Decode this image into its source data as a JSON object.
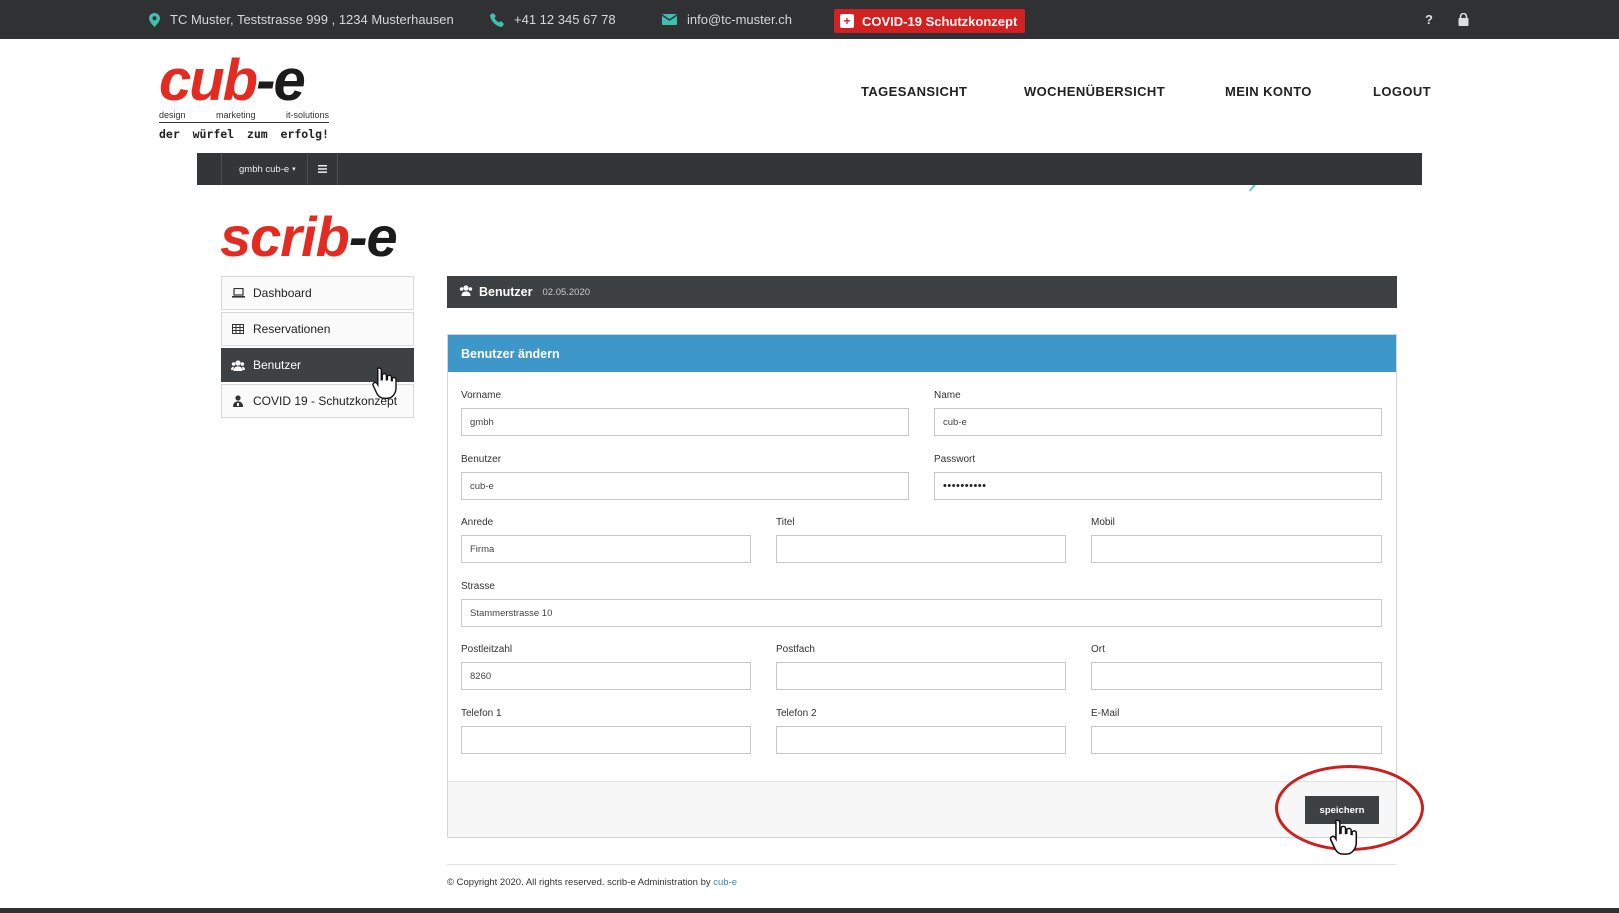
{
  "topbar": {
    "address": "TC Muster, Teststrasse 999 , 1234 Musterhausen",
    "phone": "+41 12 345 67 78",
    "email": "info@tc-muster.ch",
    "covid_button": "COVID-19 Schutzkonzept",
    "help_symbol": "?",
    "icons": [
      "location-icon",
      "phone-icon",
      "mail-icon",
      "help-icon",
      "lock-icon"
    ]
  },
  "logo": {
    "part_red": "cub",
    "part_dark": "-e",
    "tagline": [
      "design",
      "marketing",
      "it-solutions"
    ],
    "slogan": [
      "der",
      "würfel",
      "zum",
      "erfolg!"
    ]
  },
  "nav": {
    "items": [
      "TAGESANSICHT",
      "WOCHENÜBERSICHT",
      "MEIN KONTO",
      "LOGOUT"
    ]
  },
  "adminbar": {
    "user_label": "gmbh cub-e",
    "caret": "▾",
    "menu_icon": "menu-icon"
  },
  "app_logo": {
    "part_red": "scrib",
    "part_dark": "-e"
  },
  "sidebar": {
    "items": [
      {
        "label": "Dashboard",
        "icon": "laptop-icon",
        "active": false
      },
      {
        "label": "Reservationen",
        "icon": "table-icon",
        "active": false
      },
      {
        "label": "Benutzer",
        "icon": "users-icon",
        "active": true
      },
      {
        "label": "COVID 19 - Schutzkonzept",
        "icon": "person-badge-icon",
        "active": false
      }
    ]
  },
  "page_header": {
    "title": "Benutzer",
    "date": "02.05.2020",
    "icon": "users-icon"
  },
  "form": {
    "heading": "Benutzer ändern",
    "fields": {
      "vorname": {
        "label": "Vorname",
        "value": "gmbh"
      },
      "name": {
        "label": "Name",
        "value": "cub-e"
      },
      "benutzer": {
        "label": "Benutzer",
        "value": "cub-e"
      },
      "passwort": {
        "label": "Passwort",
        "value": "••••••••••"
      },
      "anrede": {
        "label": "Anrede",
        "value": "Firma"
      },
      "titel": {
        "label": "Titel",
        "value": ""
      },
      "mobil": {
        "label": "Mobil",
        "value": ""
      },
      "strasse": {
        "label": "Strasse",
        "value": "Stammerstrasse 10"
      },
      "postleitzahl": {
        "label": "Postleitzahl",
        "value": "8260"
      },
      "postfach": {
        "label": "Postfach",
        "value": ""
      },
      "ort": {
        "label": "Ort",
        "value": ""
      },
      "telefon1": {
        "label": "Telefon 1",
        "value": ""
      },
      "telefon2": {
        "label": "Telefon 2",
        "value": ""
      },
      "email": {
        "label": "E-Mail",
        "value": ""
      }
    },
    "save_label": "speichern"
  },
  "footer": {
    "text": "© Copyright 2020. All rights reserved. scrib-e Administration by",
    "link": "cub-e"
  },
  "colors": {
    "topbar_bg": "#2f3133",
    "brand_red": "#e32b21",
    "panel_head_blue": "#3d97c9",
    "dark_ui": "#3d4144",
    "accent_teal": "#3fbfaf",
    "highlight_ring": "#cc1f1f"
  }
}
